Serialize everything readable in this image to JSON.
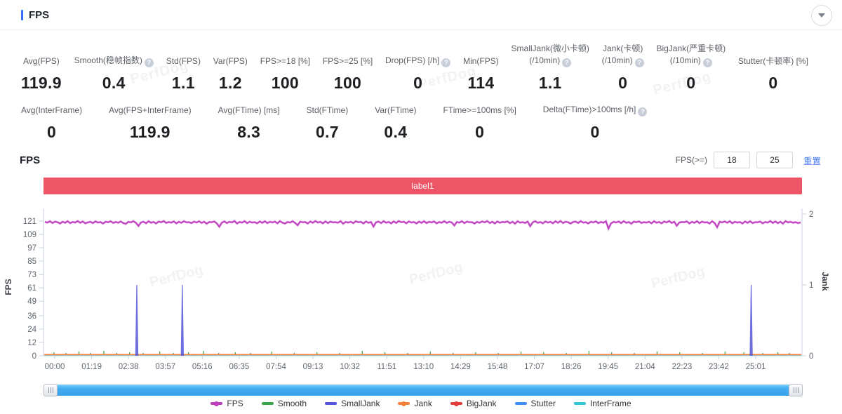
{
  "header": {
    "title": "FPS"
  },
  "watermark": "PerfDog",
  "stats_row1": [
    {
      "label": "Avg(FPS)",
      "value": "119.9"
    },
    {
      "label": "Smooth(稳帧指数)",
      "help": true,
      "value": "0.4"
    },
    {
      "label": "Std(FPS)",
      "value": "1.1"
    },
    {
      "label": "Var(FPS)",
      "value": "1.2"
    },
    {
      "label": "FPS>=18 [%]",
      "value": "100"
    },
    {
      "label": "FPS>=25 [%]",
      "value": "100"
    },
    {
      "label": "Drop(FPS) [/h]",
      "help": true,
      "value": "0"
    },
    {
      "label": "Min(FPS)",
      "value": "114"
    },
    {
      "label": "SmallJank(微小卡顿)",
      "label2": "(/10min)",
      "help": true,
      "value": "1.1"
    },
    {
      "label": "Jank(卡顿)",
      "label2": "(/10min)",
      "help": true,
      "value": "0"
    },
    {
      "label": "BigJank(严重卡顿)",
      "label2": "(/10min)",
      "help": true,
      "value": "0"
    },
    {
      "label": "Stutter(卡顿率) [%]",
      "value": "0"
    }
  ],
  "stats_row2": [
    {
      "label": "Avg(InterFrame)",
      "value": "0"
    },
    {
      "label": "Avg(FPS+InterFrame)",
      "value": "119.9"
    },
    {
      "label": "Avg(FTime) [ms]",
      "value": "8.3"
    },
    {
      "label": "Std(FTime)",
      "value": "0.7"
    },
    {
      "label": "Var(FTime)",
      "value": "0.4"
    },
    {
      "label": "FTime>=100ms [%]",
      "value": "0"
    },
    {
      "label": "Delta(FTime)>100ms [/h]",
      "help": true,
      "value": "0"
    }
  ],
  "chart_section": {
    "title": "FPS"
  },
  "chart_controls": {
    "fps_ge_label": "FPS(>=)",
    "threshold1": "18",
    "threshold2": "25",
    "reset_label": "重置"
  },
  "chart_data": {
    "type": "line",
    "annotation": {
      "label": "label1",
      "color": "#ec5666"
    },
    "left_axis": {
      "label": "FPS",
      "ticks": [
        0,
        12,
        24,
        36,
        49,
        61,
        73,
        85,
        97,
        109,
        121
      ],
      "max": 121
    },
    "right_axis": {
      "label": "Jank",
      "ticks": [
        0,
        1,
        2
      ],
      "max": 2
    },
    "x_ticks": [
      "00:00",
      "01:19",
      "02:38",
      "03:57",
      "05:16",
      "06:35",
      "07:54",
      "09:13",
      "10:32",
      "11:51",
      "13:10",
      "14:29",
      "15:48",
      "17:07",
      "18:26",
      "19:45",
      "21:04",
      "22:23",
      "23:42",
      "25:01"
    ],
    "series": [
      {
        "name": "FPS",
        "axis": "left",
        "color": "#bd3dbe",
        "values": [
          120.3,
          119.6,
          120.8,
          119.2,
          120.5,
          119.9,
          118.8,
          120.4,
          119.5,
          120.9,
          119.1,
          120.2,
          119.7,
          121.0,
          119.4,
          120.6,
          118.9,
          119.8,
          120.3,
          119.2,
          120.7,
          119.6,
          120.1,
          118.7,
          120.4,
          119.9,
          120.8,
          119.3,
          120.2,
          119.5,
          120.6,
          119.1,
          118.5,
          120.3,
          119.8,
          120.9,
          119.4,
          116.6,
          119.7,
          120.4,
          119.0,
          120.8,
          119.5,
          120.2,
          118.8,
          120.5,
          119.9,
          121.0,
          119.3,
          120.1,
          119.6,
          120.7,
          118.9,
          120.3,
          119.4,
          120.9,
          119.8,
          120.0,
          119.2,
          120.5,
          119.7,
          120.8,
          119.3,
          120.4,
          118.6,
          120.1,
          119.9,
          120.6,
          119.0,
          115.9,
          119.5,
          120.7,
          119.2,
          120.3,
          119.8,
          121.0,
          118.8,
          120.2,
          119.6,
          120.9,
          119.1,
          120.4,
          119.7,
          120.0,
          118.9,
          120.6,
          119.4,
          120.8,
          119.2,
          120.3,
          119.8,
          120.5,
          119.0,
          120.9,
          119.5,
          118.7,
          120.2,
          119.6,
          120.8,
          119.3,
          117.2,
          120.4,
          119.9,
          120.1,
          118.8,
          120.6,
          119.4,
          121.0,
          119.7,
          120.3,
          118.9,
          120.7,
          119.2,
          120.5,
          119.8,
          120.0,
          119.5,
          120.9,
          118.6,
          120.2,
          119.6,
          120.4,
          119.1,
          120.8,
          119.9,
          120.3,
          118.8,
          120.6,
          119.4,
          120.1,
          116.1,
          119.8,
          120.5,
          119.2,
          120.9,
          119.5,
          120.2,
          118.9,
          120.7,
          119.3,
          121.0,
          119.9,
          120.4,
          119.0,
          120.6,
          119.7,
          120.2,
          118.8,
          120.5,
          119.4,
          120.8,
          119.2,
          120.3,
          119.8,
          120.6,
          118.9,
          120.1,
          119.5,
          120.9,
          119.3,
          120.4,
          119.7,
          117.0,
          120.2,
          119.6,
          120.8,
          119.1,
          120.5,
          119.9,
          120.0,
          118.7,
          120.3,
          119.4,
          120.7,
          119.8,
          121.0,
          119.2,
          120.4,
          118.8,
          120.6,
          119.5,
          120.2,
          119.9,
          120.7,
          119.1,
          120.4,
          118.6,
          120.8,
          119.6,
          120.0,
          119.3,
          120.5,
          116.4,
          119.8,
          120.9,
          119.4,
          120.1,
          118.9,
          120.6,
          119.7,
          120.3,
          119.0,
          120.8,
          119.5,
          121.0,
          119.2,
          120.4,
          119.9,
          118.7,
          120.2,
          120.5,
          119.3,
          120.9,
          119.6,
          120.0,
          118.8,
          120.4,
          119.8,
          120.7,
          119.1,
          120.2,
          119.5,
          120.8,
          114.2,
          118.9,
          120.3,
          119.7,
          120.6,
          119.2,
          120.9,
          119.4,
          120.1,
          118.6,
          120.5,
          119.9,
          120.7,
          119.3,
          120.0,
          119.6,
          120.4,
          119.0,
          120.8,
          119.5,
          120.2,
          118.9,
          120.6,
          119.8,
          121.0,
          119.3,
          120.4,
          116.8,
          119.6,
          120.1,
          119.9,
          120.7,
          118.8,
          120.3,
          119.4,
          120.9,
          119.1,
          120.5,
          119.7,
          120.0,
          118.7,
          120.8,
          119.2,
          115.5,
          120.4,
          119.8,
          120.6,
          119.5,
          120.9,
          119.0,
          120.3,
          119.7,
          120.1,
          118.8,
          120.6,
          119.4,
          120.8,
          119.2,
          120.0,
          119.9,
          120.5,
          118.9,
          120.2,
          119.6,
          121.0,
          119.3,
          120.7,
          119.1,
          120.4,
          118.6,
          120.9,
          119.8,
          120.3,
          119.5,
          120.0,
          119.2,
          119.8
        ]
      },
      {
        "name": "Smooth",
        "axis": "left",
        "color": "#36a549",
        "baseline": 0,
        "ticks": [
          [
            0.012,
            3
          ],
          [
            0.028,
            2
          ],
          [
            0.045,
            4
          ],
          [
            0.06,
            2
          ],
          [
            0.078,
            5
          ],
          [
            0.095,
            2
          ],
          [
            0.112,
            3
          ],
          [
            0.13,
            2
          ],
          [
            0.152,
            4
          ],
          [
            0.17,
            2
          ],
          [
            0.19,
            3
          ],
          [
            0.21,
            5
          ],
          [
            0.23,
            2
          ],
          [
            0.252,
            3
          ],
          [
            0.272,
            2
          ],
          [
            0.3,
            4
          ],
          [
            0.33,
            2
          ],
          [
            0.36,
            3
          ],
          [
            0.39,
            2
          ],
          [
            0.42,
            5
          ],
          [
            0.45,
            3
          ],
          [
            0.48,
            2
          ],
          [
            0.51,
            4
          ],
          [
            0.54,
            2
          ],
          [
            0.57,
            3
          ],
          [
            0.6,
            2
          ],
          [
            0.63,
            4
          ],
          [
            0.66,
            3
          ],
          [
            0.69,
            2
          ],
          [
            0.72,
            5
          ],
          [
            0.75,
            3
          ],
          [
            0.78,
            2
          ],
          [
            0.81,
            4
          ],
          [
            0.84,
            3
          ],
          [
            0.87,
            2
          ],
          [
            0.9,
            4
          ],
          [
            0.925,
            3
          ],
          [
            0.95,
            2
          ],
          [
            0.97,
            3
          ],
          [
            0.985,
            2
          ]
        ]
      },
      {
        "name": "SmallJank",
        "axis": "right",
        "color": "#5356d9",
        "spikes": [
          {
            "time_s": 176,
            "frac": 0.123,
            "value": 1
          },
          {
            "time_s": 273,
            "frac": 0.183,
            "value": 1
          },
          {
            "time_s": 1491,
            "frac": 0.933,
            "value": 1
          }
        ]
      },
      {
        "name": "Jank",
        "axis": "right",
        "color": "#f5823a",
        "constant": 0
      },
      {
        "name": "BigJank",
        "axis": "right",
        "color": "#e23c3c",
        "constant": 0
      },
      {
        "name": "Stutter",
        "axis": "right",
        "color": "#3e8ef7",
        "constant": 0
      },
      {
        "name": "InterFrame",
        "axis": "left",
        "color": "#33c4d8",
        "constant": 0
      }
    ]
  },
  "legend": [
    {
      "name": "FPS",
      "color": "#bd3dbe",
      "dot": true
    },
    {
      "name": "Smooth",
      "color": "#36a549",
      "dot": false
    },
    {
      "name": "SmallJank",
      "color": "#5356d9",
      "dot": false
    },
    {
      "name": "Jank",
      "color": "#f5823a",
      "dot": true
    },
    {
      "name": "BigJank",
      "color": "#e23c3c",
      "dot": true
    },
    {
      "name": "Stutter",
      "color": "#3e8ef7",
      "dot": false
    },
    {
      "name": "InterFrame",
      "color": "#33c4d8",
      "dot": false
    }
  ]
}
